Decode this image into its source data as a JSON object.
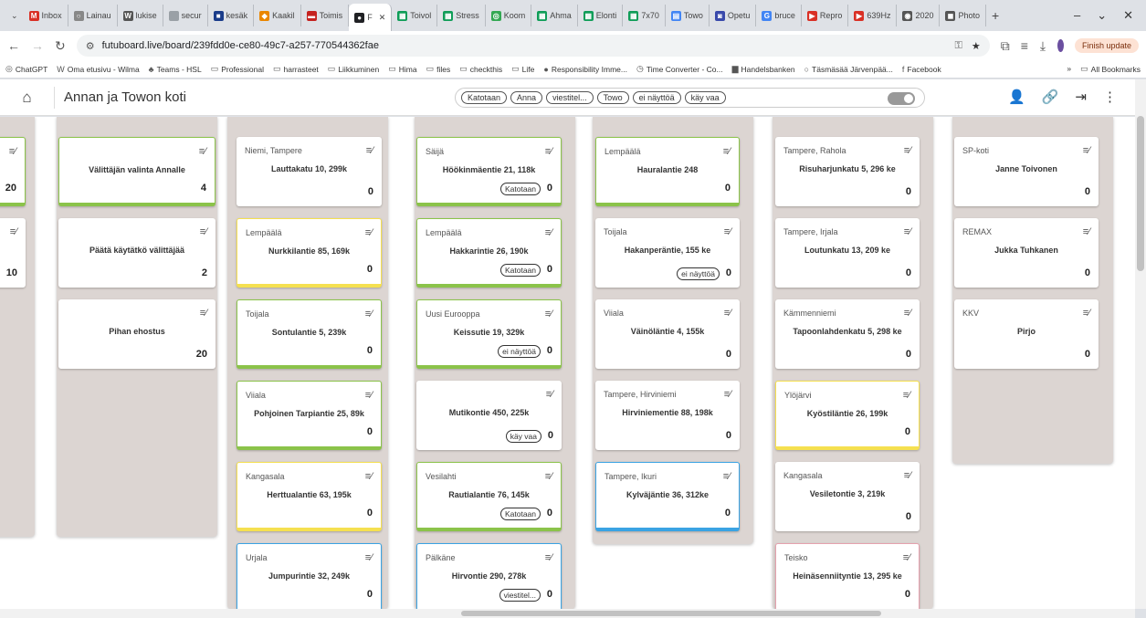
{
  "browser": {
    "tabs": [
      {
        "label": "Inbox",
        "color": "#d93025",
        "glyph": "M"
      },
      {
        "label": "Lainau",
        "color": "#888888",
        "glyph": "○"
      },
      {
        "label": "lukise",
        "color": "#555555",
        "glyph": "W"
      },
      {
        "label": "secur",
        "color": "#9aa0a6",
        "glyph": ""
      },
      {
        "label": "kesäk",
        "color": "#1a3c8a",
        "glyph": "■"
      },
      {
        "label": "Kaakil",
        "color": "#ea8600",
        "glyph": "◆"
      },
      {
        "label": "Toimis",
        "color": "#c5221f",
        "glyph": "▬"
      },
      {
        "label": "F",
        "color": "#202124",
        "glyph": "●"
      },
      {
        "label": "Toivol",
        "color": "#0f9d58",
        "glyph": "▦"
      },
      {
        "label": "Stress",
        "color": "#0f9d58",
        "glyph": "▦"
      },
      {
        "label": "Koom",
        "color": "#34a853",
        "glyph": "◎"
      },
      {
        "label": "Ahma",
        "color": "#0f9d58",
        "glyph": "▦"
      },
      {
        "label": "Elonti",
        "color": "#0f9d58",
        "glyph": "▦"
      },
      {
        "label": "7x70",
        "color": "#0f9d58",
        "glyph": "▦"
      },
      {
        "label": "Towo",
        "color": "#4285f4",
        "glyph": "▤"
      },
      {
        "label": "Opetu",
        "color": "#3949ab",
        "glyph": "◙"
      },
      {
        "label": "bruce",
        "color": "#4285f4",
        "glyph": "G"
      },
      {
        "label": "Repro",
        "color": "#d93025",
        "glyph": "▶"
      },
      {
        "label": "639Hz",
        "color": "#d93025",
        "glyph": "▶"
      },
      {
        "label": "2020",
        "color": "#555555",
        "glyph": "◉"
      },
      {
        "label": "Photo",
        "color": "#555555",
        "glyph": "◼"
      }
    ],
    "active_tab_index": 7,
    "new_tab": "+",
    "window_controls": [
      "–",
      "⌄",
      "✕"
    ],
    "url": "futuboard.live/board/239fdd0e-ce80-49c7-a257-770544362fae",
    "update_button": "Finish update",
    "bookmarks": [
      {
        "label": "ChatGPT",
        "icon": "chatgpt-icon"
      },
      {
        "label": "Oma etusivu - Wilma",
        "icon": "wilma-icon"
      },
      {
        "label": "Teams - HSL",
        "icon": "teams-icon"
      },
      {
        "label": "Professional",
        "icon": "folder-icon"
      },
      {
        "label": "harrasteet",
        "icon": "folder-icon"
      },
      {
        "label": "Liikkuminen",
        "icon": "folder-icon"
      },
      {
        "label": "Hima",
        "icon": "folder-icon"
      },
      {
        "label": "files",
        "icon": "folder-icon"
      },
      {
        "label": "checkthis",
        "icon": "folder-icon"
      },
      {
        "label": "Life",
        "icon": "folder-icon"
      },
      {
        "label": "Responsibility Imme...",
        "icon": "circle-icon"
      },
      {
        "label": "Time Converter - Co...",
        "icon": "clock-icon"
      },
      {
        "label": "Handelsbanken",
        "icon": "bank-icon"
      },
      {
        "label": "Täsmäsää Järvenpää...",
        "icon": "weather-icon"
      },
      {
        "label": "Facebook",
        "icon": "facebook-icon"
      }
    ],
    "bookmarks_more": "»",
    "all_bookmarks": "All Bookmarks"
  },
  "app": {
    "title": "Annan ja Towon koti",
    "filters": [
      "Katotaan",
      "Anna",
      "viestitel...",
      "Towo",
      "ei näyttöä",
      "käy vaa"
    ]
  },
  "columns": [
    {
      "cards": [
        {
          "loc": "",
          "title": "",
          "count": "20",
          "color": "green"
        },
        {
          "loc": "",
          "title": "",
          "count": "10",
          "color": "plain"
        }
      ]
    },
    {
      "cards": [
        {
          "loc": "",
          "title": "Välittäjän valinta Annalle",
          "count": "4",
          "color": "green"
        },
        {
          "loc": "",
          "title": "Päätä käytätkö välittäjää",
          "count": "2",
          "color": "plain"
        },
        {
          "loc": "",
          "title": "Pihan ehostus",
          "count": "20",
          "color": "plain"
        }
      ]
    },
    {
      "cards": [
        {
          "loc": "Niemi, Tampere",
          "title": "Lauttakatu 10, 299k",
          "count": "0",
          "color": "plain"
        },
        {
          "loc": "Lempäälä",
          "title": "Nurkkilantie 85, 169k",
          "count": "0",
          "color": "yellow"
        },
        {
          "loc": "Toijala",
          "title": "Sontulantie 5, 239k",
          "count": "0",
          "color": "green"
        },
        {
          "loc": "Viiala",
          "title": "Pohjoinen Tarpiantie 25, 89k",
          "count": "0",
          "color": "green"
        },
        {
          "loc": "Kangasala",
          "title": "Herttualantie 63, 195k",
          "count": "0",
          "color": "yellow"
        },
        {
          "loc": "Urjala",
          "title": "Jumpurintie 32, 249k",
          "count": "0",
          "color": "blue"
        }
      ]
    },
    {
      "cards": [
        {
          "loc": "Säijä",
          "title": "Höökinmäentie 21, 118k",
          "count": "0",
          "color": "green",
          "tag": "Katotaan"
        },
        {
          "loc": "Lempäälä",
          "title": "Hakkarintie 26, 190k",
          "count": "0",
          "color": "green",
          "tag": "Katotaan"
        },
        {
          "loc": "Uusi Eurooppa",
          "title": "Keissutie 19, 329k",
          "count": "0",
          "color": "green",
          "tag": "ei näyttöä"
        },
        {
          "loc": "",
          "title": "Mutikontie 450, 225k",
          "count": "0",
          "color": "plain",
          "tag": "käy vaa"
        },
        {
          "loc": "Vesilahti",
          "title": "Rautialantie 76, 145k",
          "count": "0",
          "color": "green",
          "tag": "Katotaan"
        },
        {
          "loc": "Pälkäne",
          "title": "Hirvontie 290, 278k",
          "count": "0",
          "color": "blue",
          "tag": "viestitel..."
        }
      ]
    },
    {
      "cards": [
        {
          "loc": "Lempäälä",
          "title": "Hauralantie 248",
          "count": "0",
          "color": "green"
        },
        {
          "loc": "Toijala",
          "title": "Hakanperäntie, 155 ke",
          "count": "0",
          "color": "plain",
          "tag": "ei näyttöä"
        },
        {
          "loc": "Viiala",
          "title": "Väinöläntie 4, 155k",
          "count": "0",
          "color": "plain"
        },
        {
          "loc": "Tampere, Hirviniemi",
          "title": "Hirviniementie 88, 198k",
          "count": "0",
          "color": "plain"
        },
        {
          "loc": "Tampere, Ikuri",
          "title": "Kylväjäntie 36, 312ke",
          "count": "0",
          "color": "blue"
        }
      ]
    },
    {
      "cards": [
        {
          "loc": "Tampere, Rahola",
          "title": "Risuharjunkatu 5, 296 ke",
          "count": "0",
          "color": "plain"
        },
        {
          "loc": "Tampere, Irjala",
          "title": "Loutunkatu 13, 209 ke",
          "count": "0",
          "color": "plain"
        },
        {
          "loc": "Kämmenniemi",
          "title": "Tapoonlahdenkatu 5, 298 ke",
          "count": "0",
          "color": "plain"
        },
        {
          "loc": "Ylöjärvi",
          "title": "Kyöstiläntie 26, 199k",
          "count": "0",
          "color": "yellow"
        },
        {
          "loc": "Kangasala",
          "title": "Vesiletontie 3, 219k",
          "count": "0",
          "color": "plain"
        },
        {
          "loc": "Teisko",
          "title": "Heinäsenniityntie 13, 295 ke",
          "count": "0",
          "color": "pink"
        }
      ]
    },
    {
      "cards": [
        {
          "loc": "SP-koti",
          "title": "Janne Toivonen",
          "count": "0",
          "color": "plain"
        },
        {
          "loc": "REMAX",
          "title": "Jukka Tuhkanen",
          "count": "0",
          "color": "plain"
        },
        {
          "loc": "KKV",
          "title": "Pirjo",
          "count": "0",
          "color": "plain"
        }
      ]
    }
  ]
}
